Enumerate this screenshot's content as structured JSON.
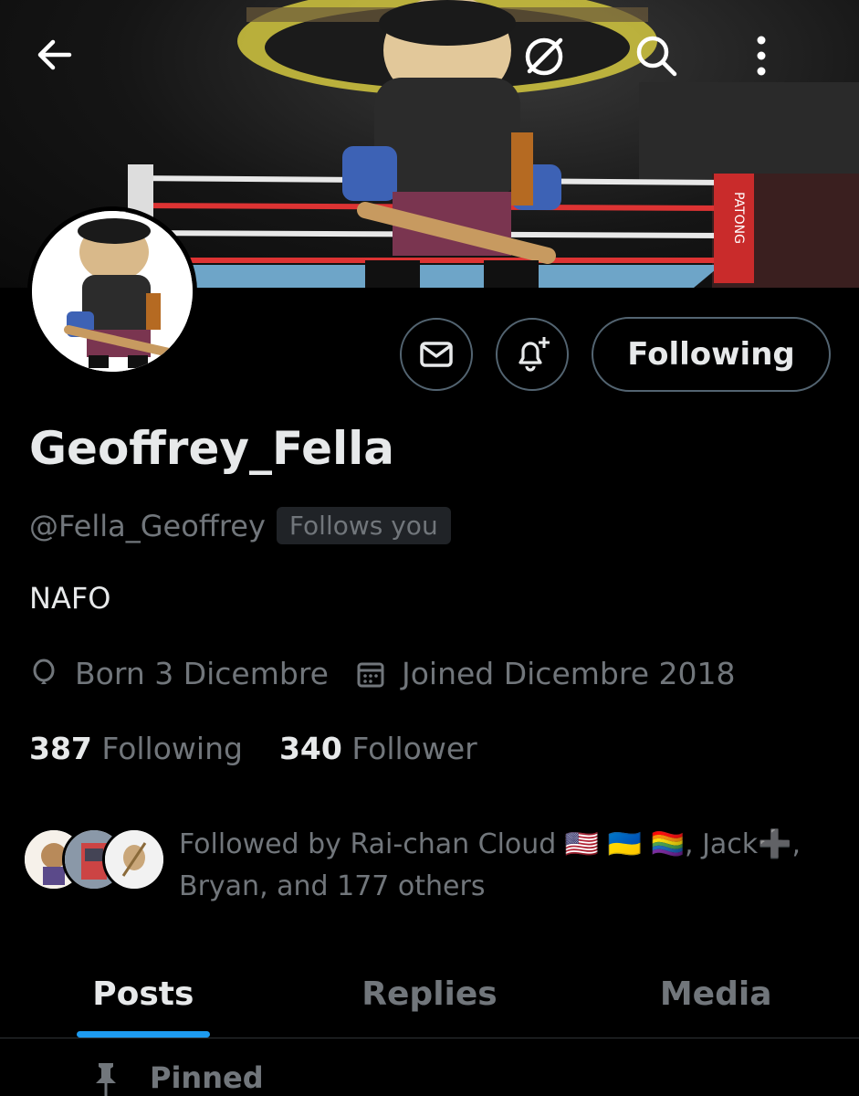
{
  "header": {
    "back_icon": "arrow-left-icon",
    "grok_icon": "grok-icon",
    "search_icon": "search-icon",
    "more_icon": "more-vertical-icon",
    "banner_text": "PATONG"
  },
  "profile": {
    "display_name": "Geoffrey_Fella",
    "handle": "@Fella_Geoffrey",
    "follows_you": "Follows you",
    "bio": "NAFO",
    "born": "Born 3 Dicembre",
    "joined": "Joined Dicembre 2018",
    "following_count": "387",
    "following_label": "Following",
    "follower_count": "340",
    "follower_label": "Follower"
  },
  "actions": {
    "message_icon": "mail-icon",
    "notify_icon": "bell-plus-icon",
    "following_button": "Following"
  },
  "followed_by": {
    "text": "Followed by Rai-chan Cloud 🇺🇸 🇺🇦 🏳️‍🌈, Jack➕, Bryan, and 177 others"
  },
  "tabs": [
    "Posts",
    "Replies",
    "Media"
  ],
  "active_tab": "Posts",
  "pinned": {
    "label": "Pinned",
    "icon": "pin-icon"
  },
  "colors": {
    "accent": "#1d9bf0",
    "muted": "#71767b",
    "text": "#e7e9ea",
    "border": "#536471"
  }
}
